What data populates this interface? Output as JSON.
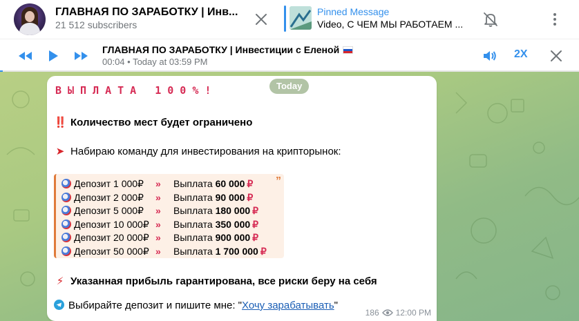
{
  "header": {
    "channel_title": "ГЛАВНАЯ ПО ЗАРАБОТКУ | Инв...",
    "subscribers": "21 512 subscribers",
    "pinned_label": "Pinned Message",
    "pinned_text": "Video, С ЧЕМ МЫ РАБОТАЕМ ..."
  },
  "player": {
    "title": "ГЛАВНАЯ ПО ЗАРАБОТКУ | Инвестиции с Еленой",
    "subtitle": "00:04 • Today at 03:59 PM",
    "speed": "2X",
    "progress": 0.005
  },
  "chat": {
    "date_pill": "Today",
    "headline": "ВЫПЛАТА 100%!",
    "line1_emoji": "‼️",
    "line1": "Количество мест будет ограничено",
    "line2_emoji": "➤",
    "line2": "Набираю команду для инвестирования на крипторынок:",
    "rows": [
      {
        "deposit": "Депозит 1 000₽",
        "arrows": "»",
        "payout_label": "Выплата",
        "payout": "60 000",
        "rub": "₽"
      },
      {
        "deposit": "Депозит 2 000₽",
        "arrows": "»",
        "payout_label": "Выплата",
        "payout": "90 000",
        "rub": "₽"
      },
      {
        "deposit": "Депозит 5 000₽",
        "arrows": "»",
        "payout_label": "Выплата",
        "payout": "180 000",
        "rub": "₽"
      },
      {
        "deposit": "Депозит 10 000₽",
        "arrows": "»",
        "payout_label": "Выплата",
        "payout": "350 000",
        "rub": "₽"
      },
      {
        "deposit": "Депозит 20 000₽",
        "arrows": "»",
        "payout_label": "Выплата",
        "payout": "900 000",
        "rub": "₽"
      },
      {
        "deposit": "Депозит 50 000₽",
        "arrows": "»",
        "payout_label": "Выплата",
        "payout": "1 700 000",
        "rub": "₽"
      }
    ],
    "quote_mark": "”",
    "line3_emoji": "⚡",
    "line3": "Указанная прибыль гарантирована, все риски беру на себя",
    "line4_prefix": "Выбирайте депозит и пишите мне: \"",
    "line4_link": "Хочу зарабатывать",
    "line4_suffix": "\"",
    "views": "186",
    "time": "12:00 PM"
  },
  "colors": {
    "accent": "#3390ec",
    "headline": "#d62b54",
    "quote_border": "#e07a3a"
  },
  "icons": [
    "close-icon",
    "mute-bell-icon",
    "more-vertical-icon",
    "rewind-icon",
    "play-icon",
    "forward-icon",
    "volume-icon",
    "close-player-icon",
    "eye-icon",
    "telegram-icon"
  ]
}
